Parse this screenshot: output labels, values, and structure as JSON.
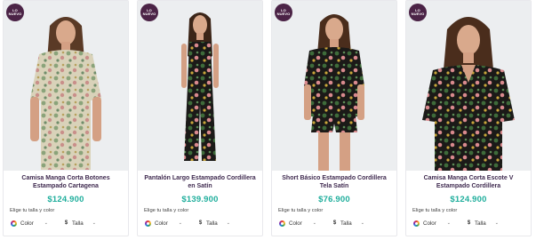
{
  "products": [
    {
      "badge": "LO\nNUEVO",
      "name": "Camisa Manga Corta Botones Estampado Cartagena",
      "price": "$124.900",
      "choose_label": "Elige tu talla y color",
      "color_label": "Color",
      "size_label": "Talla",
      "print": "light-floral"
    },
    {
      "badge": "LO\nNUEVO",
      "name": "Pantalón Largo Estampado Cordillera en Satín",
      "price": "$139.900",
      "choose_label": "Elige tu talla y color",
      "color_label": "Color",
      "size_label": "Talla",
      "print": "dark-floral"
    },
    {
      "badge": "LO\nNUEVO",
      "name": "Short Básico Estampado Cordillera Tela Satín",
      "price": "$76.900",
      "choose_label": "Elige tu talla y color",
      "color_label": "Color",
      "size_label": "Talla",
      "print": "dark-floral"
    },
    {
      "badge": "LO\nNUEVO",
      "name": "Camisa Manga Corta Escote V Estampado Cordillera",
      "price": "$124.900",
      "choose_label": "Elige tu talla y color",
      "color_label": "Color",
      "size_label": "Talla",
      "print": "dark-floral"
    }
  ],
  "colors": {
    "badge_bg": "#4b2346",
    "title": "#3f2a4f",
    "price": "#1fae9c",
    "photo_bg": "#eeeff1"
  }
}
